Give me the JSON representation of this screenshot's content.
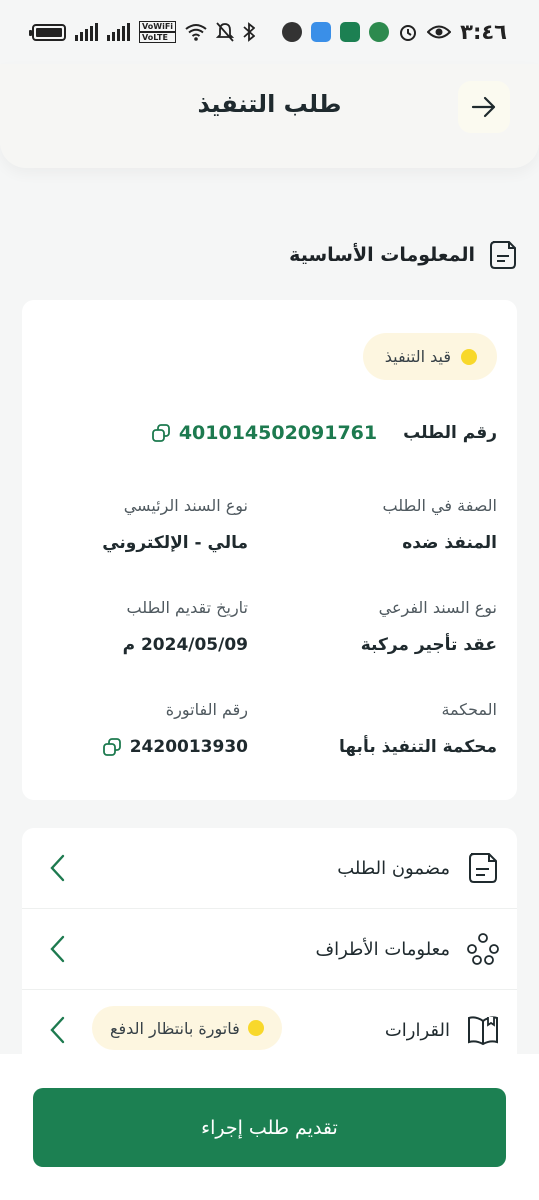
{
  "status_bar": {
    "time": "٣:٤٦",
    "network_badge_top": "VoWiFi",
    "network_badge_bottom": "VoLTE"
  },
  "header": {
    "title": "طلب التنفيذ",
    "back_icon": "arrow-right-icon"
  },
  "section": {
    "title": "المعلومات الأساسية",
    "icon": "document-icon"
  },
  "info": {
    "status": "قيد التنفيذ",
    "status_color": "#f8d82b",
    "request_number_label": "رقم الطلب",
    "request_number": "401014502091761",
    "fields": {
      "capacity_label": "الصفة في الطلب",
      "capacity_value": "المنفذ ضده",
      "main_bond_label": "نوع السند الرئيسي",
      "main_bond_value": "مالي - الإلكتروني",
      "sub_bond_label": "نوع السند الفرعي",
      "sub_bond_value": "عقد تأجير مركبة",
      "date_label": "تاريخ تقديم الطلب",
      "date_value": "2024/05/09 م",
      "court_label": "المحكمة",
      "court_value": "محكمة التنفيذ بأبها",
      "invoice_label": "رقم الفاتورة",
      "invoice_value": "2420013930"
    }
  },
  "menu": {
    "items": [
      {
        "label": "مضمون الطلب",
        "icon": "document-icon"
      },
      {
        "label": "معلومات الأطراف",
        "icon": "parties-icon"
      },
      {
        "label": "القرارات",
        "icon": "book-icon",
        "badge": "فاتورة بانتظار الدفع"
      }
    ]
  },
  "footer": {
    "primary_button": "تقديم طلب إجراء"
  },
  "colors": {
    "accent_green": "#1c8052",
    "link_green": "#1d7a4f",
    "pill_bg": "#fdf6e0"
  }
}
